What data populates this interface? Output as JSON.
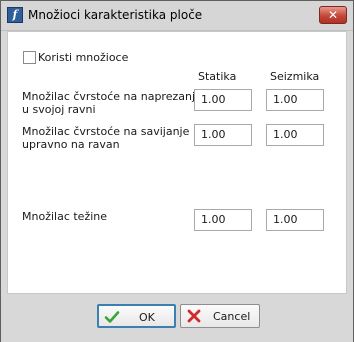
{
  "window": {
    "title": "Množioci karakteristika ploče",
    "app_icon": "app-icon",
    "close_icon": "close-icon"
  },
  "form": {
    "use_multipliers": {
      "label": "Koristi množioce",
      "checked": false
    },
    "columns": {
      "static": "Statika",
      "seismic": "Seizmika"
    },
    "rows": [
      {
        "label_line1": "Množilac čvrstoće na naprezanje",
        "label_line2": "u svojoj ravni",
        "static": "1.00",
        "seismic": "1.00"
      },
      {
        "label_line1": "Množilac čvrstoće na savijanje",
        "label_line2": "upravno na ravan",
        "static": "1.00",
        "seismic": "1.00"
      },
      {
        "label_line1": "Množilac težine",
        "label_line2": "",
        "static": "1.00",
        "seismic": "1.00"
      }
    ]
  },
  "buttons": {
    "ok": {
      "label": "OK",
      "icon": "checkmark-icon",
      "color": "#3aa43a"
    },
    "cancel": {
      "label": "Cancel",
      "icon": "cross-icon",
      "color": "#d22a2a"
    }
  }
}
